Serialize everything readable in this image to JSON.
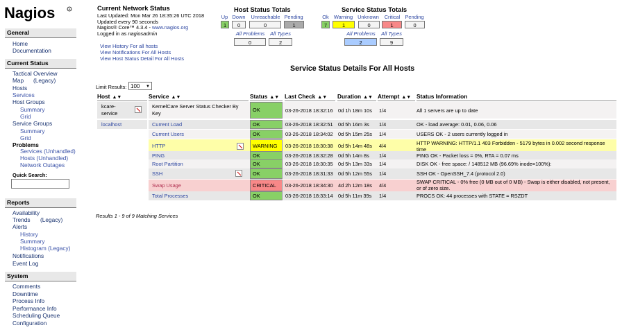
{
  "logo": "Nagios",
  "sidebar": {
    "general": {
      "title": "General",
      "links": [
        "Home",
        "Documentation"
      ]
    },
    "current": {
      "title": "Current Status",
      "tactical": "Tactical Overview",
      "map": "Map",
      "map_legacy": "(Legacy)",
      "hosts": "Hosts",
      "services": "Services",
      "host_groups": "Host Groups",
      "hg_summary": "Summary",
      "hg_grid": "Grid",
      "service_groups": "Service Groups",
      "sg_summary": "Summary",
      "sg_grid": "Grid",
      "problems": "Problems",
      "pr_services": "Services (Unhandled)",
      "pr_hosts": "Hosts (Unhandled)",
      "pr_network": "Network Outages",
      "quick_search": "Quick Search:"
    },
    "reports": {
      "title": "Reports",
      "availability": "Availability",
      "trends": "Trends",
      "trends_legacy": "(Legacy)",
      "alerts": "Alerts",
      "history": "History",
      "summary": "Summary",
      "histogram": "Histogram (Legacy)",
      "notifications": "Notifications",
      "event_log": "Event Log"
    },
    "system": {
      "title": "System",
      "comments": "Comments",
      "downtime": "Downtime",
      "process_info": "Process Info",
      "performance_info": "Performance Info",
      "scheduling_queue": "Scheduling Queue",
      "configuration": "Configuration"
    }
  },
  "network_status": {
    "title": "Current Network Status",
    "last_updated": "Last Updated: Mon Mar 26 18:35:26 UTC 2018",
    "interval": "Updated every 90 seconds",
    "version_prefix": "Nagios® Core™ 4.3.4 - ",
    "version_link": "www.nagios.org",
    "logged_in_prefix": "Logged in as ",
    "logged_in_user": "nagiosadmin",
    "links": [
      "View History For all hosts",
      "View Notifications For All Hosts",
      "View Host Status Detail For All Hosts"
    ]
  },
  "host_totals": {
    "title": "Host Status Totals",
    "headers": [
      "Up",
      "Down",
      "Unreachable",
      "Pending"
    ],
    "values": [
      "1",
      "0",
      "0",
      "1"
    ],
    "all_headers": [
      "All Problems",
      "All Types"
    ],
    "all_values": [
      "0",
      "2"
    ]
  },
  "service_totals": {
    "title": "Service Status Totals",
    "headers": [
      "Ok",
      "Warning",
      "Unknown",
      "Critical",
      "Pending"
    ],
    "values": [
      "7",
      "1",
      "0",
      "1",
      "0"
    ],
    "all_headers": [
      "All Problems",
      "All Types"
    ],
    "all_values": [
      "2",
      "9"
    ]
  },
  "main": {
    "title": "Service Status Details For All Hosts",
    "limit_label": "Limit Results:",
    "limit_value": "100",
    "results": "Results 1 - 9 of 9 Matching Services"
  },
  "table": {
    "headers": [
      "Host",
      "Service",
      "Status",
      "Last Check",
      "Duration",
      "Attempt",
      "Status Information"
    ],
    "hosts": [
      "kcare-service",
      "localhost"
    ],
    "rows": [
      {
        "service": "KernelCare Server Status Checker By Key",
        "status": "OK",
        "last_check": "03-26-2018 18:32:16",
        "duration": "0d 1h 18m 10s",
        "attempt": "1/4",
        "info": "All 1 servers are up to date"
      },
      {
        "service": "Current Load",
        "status": "OK",
        "last_check": "03-26-2018 18:32:51",
        "duration": "0d 5h 16m 3s",
        "attempt": "1/4",
        "info": "OK - load average: 0.01, 0.06, 0.06"
      },
      {
        "service": "Current Users",
        "status": "OK",
        "last_check": "03-26-2018 18:34:02",
        "duration": "0d 5h 15m 25s",
        "attempt": "1/4",
        "info": "USERS OK - 2 users currently logged in"
      },
      {
        "service": "HTTP",
        "status": "WARNING",
        "last_check": "03-26-2018 18:30:38",
        "duration": "0d 5h 14m 48s",
        "attempt": "4/4",
        "info": "HTTP WARNING: HTTP/1.1 403 Forbidden - 5179 bytes in 0.002 second response time"
      },
      {
        "service": "PING",
        "status": "OK",
        "last_check": "03-26-2018 18:32:28",
        "duration": "0d 5h 14m 8s",
        "attempt": "1/4",
        "info": "PING OK - Packet loss = 0%, RTA = 0.07 ms"
      },
      {
        "service": "Root Partition",
        "status": "OK",
        "last_check": "03-26-2018 18:30:35",
        "duration": "0d 5h 13m 33s",
        "attempt": "1/4",
        "info": "DISK OK - free space: / 148512 MB (96.69% inode=100%):"
      },
      {
        "service": "SSH",
        "status": "OK",
        "last_check": "03-26-2018 18:31:33",
        "duration": "0d 5h 12m 55s",
        "attempt": "1/4",
        "info": "SSH OK - OpenSSH_7.4 (protocol 2.0)"
      },
      {
        "service": "Swap Usage",
        "status": "CRITICAL",
        "last_check": "03-26-2018 18:34:30",
        "duration": "4d 2h 12m 18s",
        "attempt": "4/4",
        "info": "SWAP CRITICAL - 0% free (0 MB out of 0 MB) - Swap is either disabled, not present, or of zero size."
      },
      {
        "service": "Total Processes",
        "status": "OK",
        "last_check": "03-26-2018 18:33:14",
        "duration": "0d 5h 11m 39s",
        "attempt": "1/4",
        "info": "PROCS OK: 44 processes with STATE = RSZDT"
      }
    ]
  },
  "colors": {
    "ok": "#88d066",
    "warning": "#ffff00",
    "critical": "#f88888",
    "link": "#2a44a0"
  }
}
